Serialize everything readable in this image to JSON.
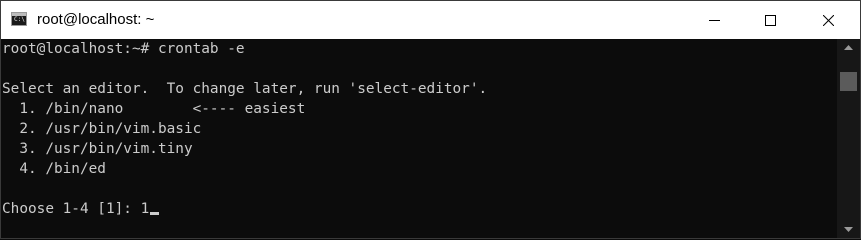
{
  "window": {
    "title": "root@localhost: ~",
    "icons": {
      "app": "terminal-icon",
      "minimize": "minimize-icon",
      "maximize": "maximize-icon",
      "close": "close-icon"
    }
  },
  "terminal": {
    "lines": [
      "root@localhost:~# crontab -e",
      "",
      "Select an editor.  To change later, run 'select-editor'.",
      "  1. /bin/nano        <---- easiest",
      "  2. /usr/bin/vim.basic",
      "  3. /usr/bin/vim.tiny",
      "  4. /bin/ed",
      "",
      "Choose 1-4 [1]: 1"
    ],
    "text_color": "#cccccc",
    "background_color": "#0c0c0c"
  },
  "scrollbar": {
    "thumb_color": "#5b5b5b",
    "track_color": "#171717"
  }
}
